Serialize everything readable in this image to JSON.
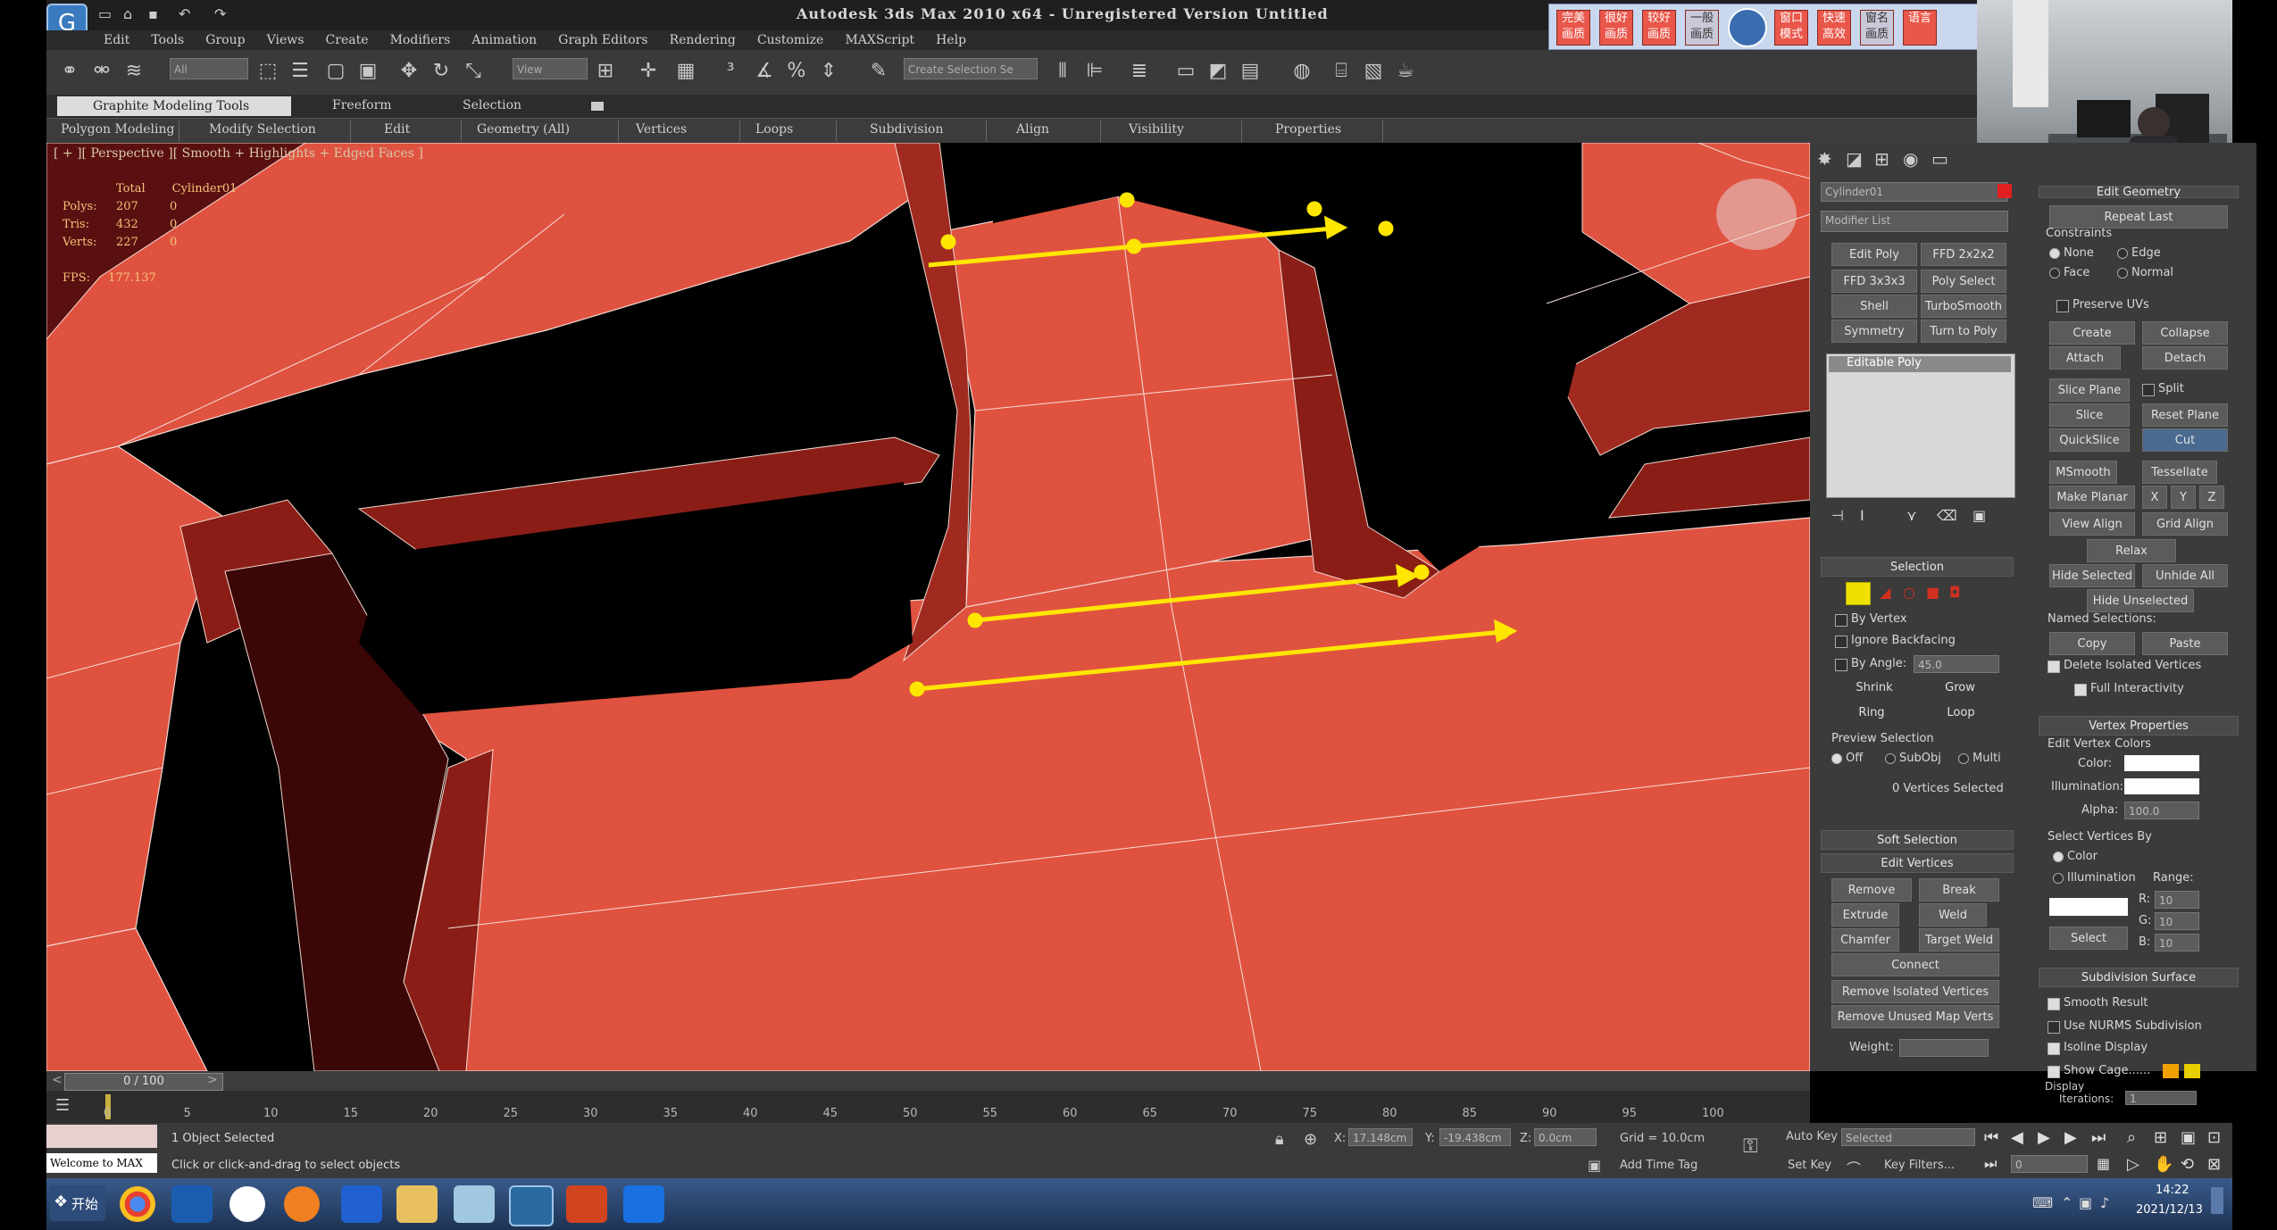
{
  "window": {
    "title": "Autodesk 3ds Max  2010 x64  - Unregistered Version  Untitled",
    "app_icon": "3ds-max-logo"
  },
  "menu": [
    "Edit",
    "Tools",
    "Group",
    "Views",
    "Create",
    "Modifiers",
    "Animation",
    "Graph Editors",
    "Rendering",
    "Customize",
    "MAXScript",
    "Help"
  ],
  "toolbar": {
    "selection_filter": "All",
    "ref_coord": "View",
    "named_selection": "Create Selection Se"
  },
  "chinese_toolbar": [
    "完美画质",
    "很好画质",
    "较好画质",
    "一般画质",
    "",
    "窗口模式",
    "快速高效",
    "窗名画质",
    "语言"
  ],
  "ribbon": {
    "tabs": [
      "Graphite Modeling Tools",
      "Freeform",
      "Selection"
    ],
    "subtabs": [
      "Polygon Modeling",
      "Modify Selection",
      "Edit",
      "Geometry (All)",
      "Vertices",
      "Loops",
      "Subdivision",
      "Align",
      "Visibility",
      "Properties"
    ]
  },
  "viewport": {
    "label": "[ + ][ Perspective ][ Smooth + Highlights + Edged Faces ]",
    "stats": {
      "header_total": "Total",
      "header_obj": "Cylinder01",
      "rows": [
        {
          "label": "Polys:",
          "total": "207",
          "sel": "0"
        },
        {
          "label": "Tris:",
          "total": "432",
          "sel": "0"
        },
        {
          "label": "Verts:",
          "total": "227",
          "sel": "0"
        }
      ],
      "fps_label": "FPS:",
      "fps": "177.137"
    },
    "mesh_color": "#e05240",
    "annotation_color": "#ffe600"
  },
  "command_panel": {
    "object_name": "Cylinder01",
    "modifier_list": "Modifier List",
    "modifier_buttons": [
      "Edit Poly",
      "FFD 2x2x2",
      "FFD 3x3x3",
      "Poly Select",
      "Shell",
      "TurboSmooth",
      "Symmetry",
      "Turn to Poly"
    ],
    "stack_item": "Editable Poly",
    "selection": {
      "title": "Selection",
      "by_vertex": "By Vertex",
      "ignore_backfacing": "Ignore Backfacing",
      "by_angle": "By Angle:",
      "angle": "45.0",
      "shrink": "Shrink",
      "grow": "Grow",
      "ring": "Ring",
      "loop": "Loop",
      "preview_title": "Preview Selection",
      "preview_off": "Off",
      "preview_subobj": "SubObj",
      "preview_multi": "Multi",
      "status": "0 Vertices Selected"
    },
    "soft_selection": "Soft Selection",
    "edit_vertices": {
      "title": "Edit Vertices",
      "remove": "Remove",
      "break": "Break",
      "extrude": "Extrude",
      "weld": "Weld",
      "chamfer": "Chamfer",
      "target_weld": "Target Weld",
      "connect": "Connect",
      "remove_isolated": "Remove Isolated Vertices",
      "remove_unused": "Remove Unused Map Verts",
      "weight": "Weight:"
    },
    "edit_geometry": {
      "title": "Edit Geometry",
      "repeat_last": "Repeat Last",
      "constraints": "Constraints",
      "c_none": "None",
      "c_edge": "Edge",
      "c_face": "Face",
      "c_normal": "Normal",
      "preserve_uvs": "Preserve UVs",
      "create": "Create",
      "collapse": "Collapse",
      "attach": "Attach",
      "detach": "Detach",
      "slice_plane": "Slice Plane",
      "split": "Split",
      "slice": "Slice",
      "reset_plane": "Reset Plane",
      "quickslice": "QuickSlice",
      "cut": "Cut",
      "msmooth": "MSmooth",
      "tessellate": "Tessellate",
      "make_planar": "Make Planar",
      "x": "X",
      "y": "Y",
      "z": "Z",
      "view_align": "View Align",
      "grid_align": "Grid Align",
      "relax": "Relax",
      "hide_selected": "Hide Selected",
      "unhide_all": "Unhide All",
      "hide_unselected": "Hide Unselected",
      "named_selections": "Named Selections:",
      "copy": "Copy",
      "paste": "Paste",
      "delete_isolated": "Delete Isolated Vertices",
      "full_interactivity": "Full Interactivity"
    },
    "vertex_properties": {
      "title": "Vertex Properties",
      "edit_colors": "Edit Vertex Colors",
      "color": "Color:",
      "illumination": "Illumination:",
      "alpha": "Alpha:",
      "alpha_val": "100.0",
      "select_by": "Select Vertices By",
      "sb_color": "Color",
      "sb_illum": "Illumination",
      "range": "Range:",
      "r": "R:",
      "g": "G:",
      "b": "B:",
      "rv": "10",
      "gv": "10",
      "bv": "10",
      "select": "Select"
    },
    "subdivision": {
      "title": "Subdivision Surface",
      "smooth_result": "Smooth Result",
      "use_nurms": "Use NURMS Subdivision",
      "isoline": "Isoline Display",
      "show_cage": "Show Cage......",
      "display": "Display",
      "iterations": "Iterations:",
      "iter_val": "1"
    }
  },
  "timeline": {
    "frame": "0 / 100",
    "ticks": [
      "0",
      "5",
      "10",
      "15",
      "20",
      "25",
      "30",
      "35",
      "40",
      "45",
      "50",
      "55",
      "60",
      "65",
      "70",
      "75",
      "80",
      "85",
      "90",
      "95",
      "100"
    ]
  },
  "status": {
    "welcome": "Welcome to MAX",
    "objects": "1 Object Selected",
    "prompt": "Click or click-and-drag to select objects",
    "x_label": "X:",
    "x": "17.148cm",
    "y_label": "Y:",
    "y": "-19.438cm",
    "z_label": "Z:",
    "z": "0.0cm",
    "grid": "Grid = 10.0cm",
    "add_time_tag": "Add Time Tag",
    "auto_key": "Auto Key",
    "set_key": "Set Key",
    "key_mode": "Selected",
    "key_filters": "Key Filters...",
    "frame_field": "0"
  },
  "taskbar": {
    "start": "开始",
    "time": "14:22",
    "date": "2021/12/13"
  }
}
